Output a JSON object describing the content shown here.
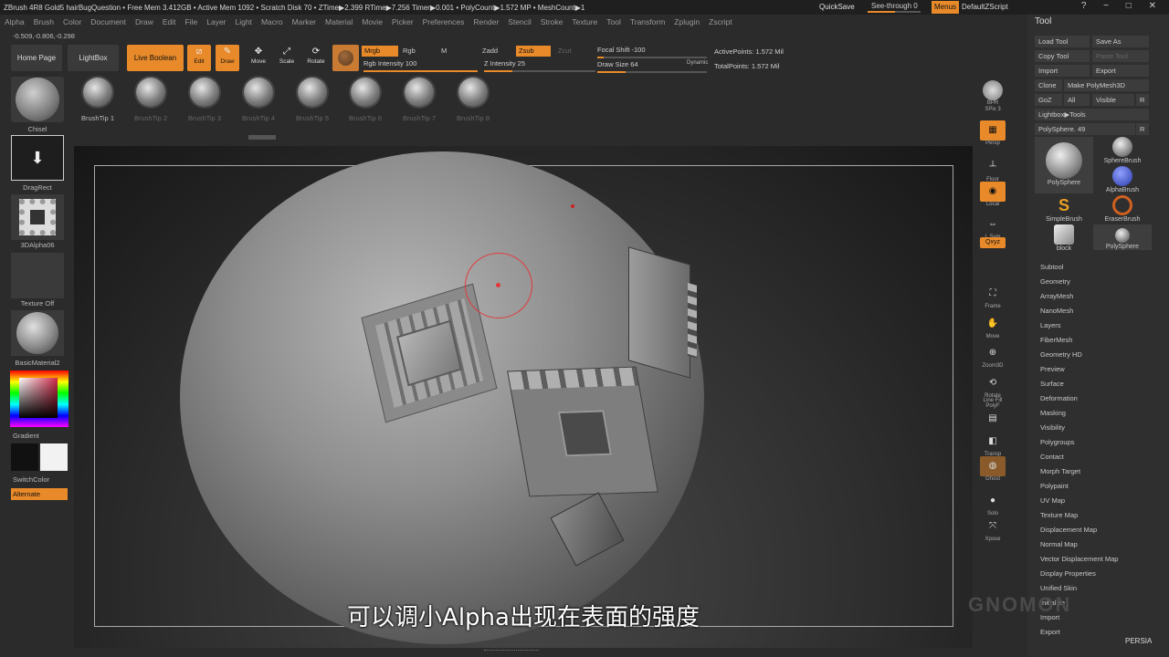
{
  "titlebar": {
    "text": "ZBrush 4R8 Gold5    hairBugQuestion    • Free Mem 3.412GB • Active Mem 1092 • Scratch Disk 70 • ZTime▶2.399 RTime▶7.256 Timer▶0.001 • PolyCount▶1.572 MP • MeshCount▶1",
    "quicksave": "QuickSave",
    "see_through": "See-through  0",
    "menus": "Menus",
    "default_zscript": "DefaultZScript"
  },
  "menubar": [
    "Alpha",
    "Brush",
    "Color",
    "Document",
    "Draw",
    "Edit",
    "File",
    "Layer",
    "Light",
    "Macro",
    "Marker",
    "Material",
    "Movie",
    "Picker",
    "Preferences",
    "Render",
    "Stencil",
    "Stroke",
    "Texture",
    "Tool",
    "Transform",
    "Zplugin",
    "Zscript"
  ],
  "coords": "-0.509,-0.806,-0.298",
  "shelf": {
    "home_page": "Home Page",
    "lightbox": "LightBox",
    "live_boolean": "Live Boolean",
    "edit": "Edit",
    "draw": "Draw",
    "move": "Move",
    "scale": "Scale",
    "rotate": "Rotate",
    "mrgb": "Mrgb",
    "rgb": "Rgb",
    "m": "M",
    "zadd": "Zadd",
    "zsub": "Zsub",
    "zcut": "Zcut",
    "rgb_intensity": "Rgb Intensity 100",
    "z_intensity": "Z Intensity 25",
    "focal_shift": "Focal Shift -100",
    "draw_size": "Draw Size 64",
    "dynamic": "Dynamic",
    "active_points": "ActivePoints: 1.572 Mil",
    "total_points": "TotalPoints: 1.572 Mil"
  },
  "brush_tips": [
    "BrushTip 1",
    "BrushTip 2",
    "BrushTip 3",
    "BrushTip 4",
    "BrushTip 5",
    "BrushTip 6",
    "BrushTip 7",
    "BrushTip 8"
  ],
  "left": {
    "chisel": "Chisel",
    "dragrect": "DragRect",
    "alpha": "3DAlpha06",
    "texture": "Texture Off",
    "material": "BasicMaterial2",
    "gradient": "Gradient",
    "switchcolor": "SwitchColor",
    "alternate": "Alternate"
  },
  "subtitle": "可以调小Alpha出现在表面的强度",
  "right_dock": [
    "BPR",
    "SPix 3",
    "Persp",
    "Floor",
    "Local",
    "L.Sym",
    "Qxyz",
    "Frame",
    "Move",
    "Zoom3D",
    "Rotate",
    "Line Fill PolyF",
    "Transp",
    "Ghost",
    "Solo",
    "Xpose"
  ],
  "tool": {
    "title": "Tool",
    "load_tool": "Load Tool",
    "save_as": "Save As",
    "copy_tool": "Copy Tool",
    "paste_tool": "Paste Tool",
    "import": "Import",
    "export": "Export",
    "clone": "Clone",
    "make_polymesh": "Make PolyMesh3D",
    "goz": "GoZ",
    "all": "All",
    "visible": "Visible",
    "r": "R",
    "lightbox_tools": "Lightbox▶Tools",
    "polysphere_slider": "PolySphere. 49",
    "meshes": [
      "PolySphere",
      "SphereBrush",
      "AlphaBrush",
      "SimpleBrush",
      "EraserBrush",
      "block",
      "PolySphere"
    ],
    "sublist": [
      "Subtool",
      "Geometry",
      "ArrayMesh",
      "NanoMesh",
      "Layers",
      "FiberMesh",
      "Geometry HD",
      "Preview",
      "Surface",
      "Deformation",
      "Masking",
      "Visibility",
      "Polygroups",
      "Contact",
      "Morph Target",
      "Polypaint",
      "UV Map",
      "Texture Map",
      "Displacement Map",
      "Normal Map",
      "Vector Displacement Map",
      "Display Properties",
      "Unified Skin",
      "Initialize",
      "Import",
      "Export"
    ]
  },
  "watermark": "PERSIA",
  "colors": {
    "accent": "#e88a2a",
    "cursor": "#e23a3a",
    "bg": "#2b2b2b"
  }
}
